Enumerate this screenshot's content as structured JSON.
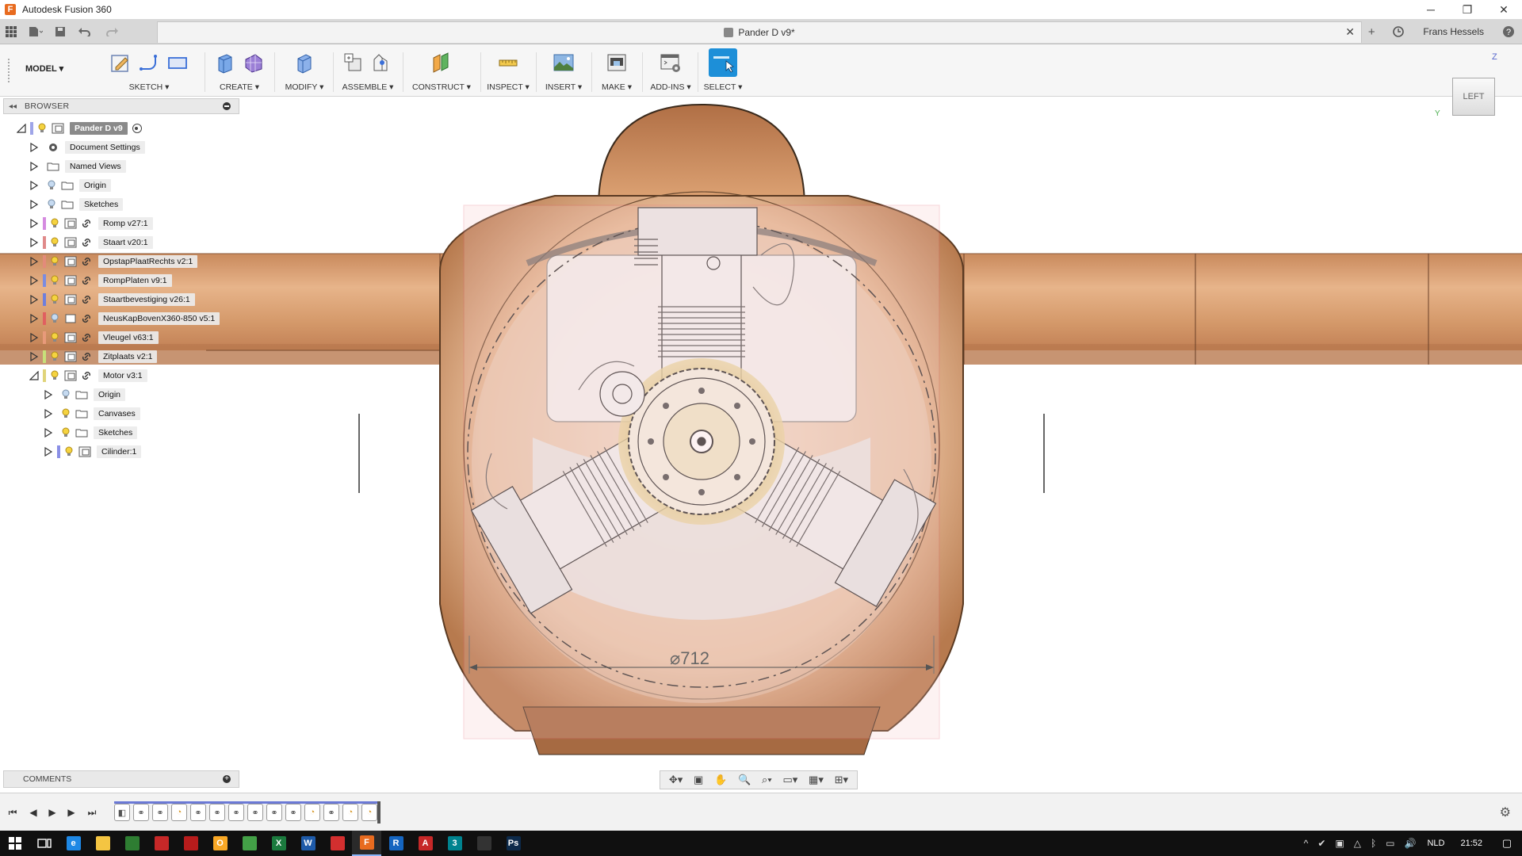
{
  "titlebar": {
    "app_title": "Autodesk Fusion 360",
    "icon_letter": "F",
    "minimize": "─",
    "restore": "❐",
    "close": "✕"
  },
  "tabbar": {
    "doc_title": "Pander D v9*",
    "close": "✕",
    "new_tab": "+",
    "user_name": "Frans Hessels",
    "help": "?"
  },
  "toolbar": {
    "workspace": "MODEL ▾",
    "groups": [
      "SKETCH ▾",
      "CREATE ▾",
      "MODIFY ▾",
      "ASSEMBLE ▾",
      "CONSTRUCT ▾",
      "INSPECT ▾",
      "INSERT ▾",
      "MAKE ▾",
      "ADD-INS ▾",
      "SELECT ▾"
    ]
  },
  "browser": {
    "title": "BROWSER",
    "collapse": "◂◂",
    "root": "Pander D v9",
    "items": [
      {
        "label": "Document Settings"
      },
      {
        "label": "Named Views"
      },
      {
        "label": "Origin"
      },
      {
        "label": "Sketches"
      },
      {
        "label": "Romp v27:1"
      },
      {
        "label": "Staart v20:1"
      },
      {
        "label": "OpstapPlaatRechts v2:1"
      },
      {
        "label": "RompPlaten v9:1"
      },
      {
        "label": "Staartbevestiging v26:1"
      },
      {
        "label": "NeusKapBovenX360-850 v5:1"
      },
      {
        "label": "Vleugel v63:1"
      },
      {
        "label": "Zitplaats v2:1"
      },
      {
        "label": "Motor v3:1"
      },
      {
        "label": "Origin"
      },
      {
        "label": "Canvases"
      },
      {
        "label": "Sketches"
      },
      {
        "label": "Cilinder:1"
      }
    ]
  },
  "viewcube": {
    "face": "LEFT",
    "axis_z": "Z",
    "axis_y": "Y"
  },
  "viewport": {
    "dimension_label": "⌀712"
  },
  "comments": {
    "title": "COMMENTS",
    "add": "+"
  },
  "navbar": {
    "orbit": "✥▾",
    "look": "▣",
    "pan": "✋",
    "zoom": "🔍",
    "fit": "⌕▾",
    "display": "▭▾",
    "grid": "▦▾",
    "viewports": "⊞▾"
  },
  "timeline": {
    "first": "⏮",
    "prev": "◀",
    "play": "▶",
    "next": "▶",
    "last": "⏭",
    "settings": "⚙"
  },
  "taskbar": {
    "lang": "NLD",
    "time": "21:52",
    "apps": [
      {
        "name": "edge",
        "letter": "e",
        "color": "#1e88e5"
      },
      {
        "name": "explorer",
        "letter": "",
        "color": "#f4c542"
      },
      {
        "name": "app-green",
        "letter": "",
        "color": "#2e7d32"
      },
      {
        "name": "app-pdf",
        "letter": "",
        "color": "#c62828"
      },
      {
        "name": "app-red2",
        "letter": "",
        "color": "#b71c1c"
      },
      {
        "name": "app-yellow",
        "letter": "O",
        "color": "#f9a825"
      },
      {
        "name": "chrome",
        "letter": "",
        "color": "#43a047"
      },
      {
        "name": "excel",
        "letter": "X",
        "color": "#1b7a3e"
      },
      {
        "name": "word",
        "letter": "W",
        "color": "#1e5aa8"
      },
      {
        "name": "app-red3",
        "letter": "",
        "color": "#d32f2f"
      },
      {
        "name": "fusion",
        "letter": "F",
        "color": "#e86b1f"
      },
      {
        "name": "revit",
        "letter": "R",
        "color": "#1565c0"
      },
      {
        "name": "autocad",
        "letter": "A",
        "color": "#c62828"
      },
      {
        "name": "app-teal",
        "letter": "3",
        "color": "#00838f"
      },
      {
        "name": "app-dark",
        "letter": "",
        "color": "#333333"
      },
      {
        "name": "photoshop",
        "letter": "Ps",
        "color": "#0d2a4a"
      }
    ]
  },
  "colors": {
    "wood": "#d49a6a",
    "accent": "#2a8fd6",
    "selection_box": "#e45b6b"
  }
}
